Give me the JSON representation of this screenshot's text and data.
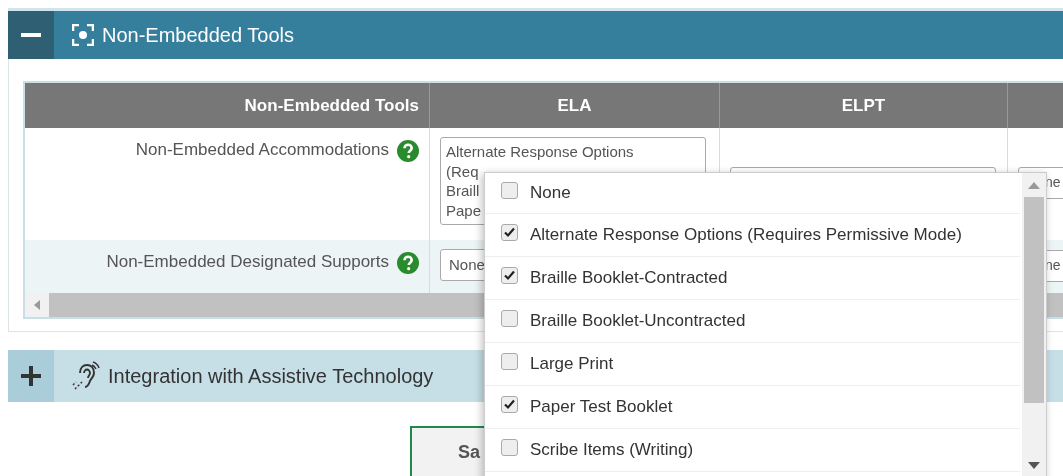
{
  "sections": [
    {
      "title": "Non-Embedded Tools",
      "expanded": true,
      "table": {
        "columns": [
          "Non-Embedded Tools",
          "ELA",
          "ELPT"
        ],
        "rows": [
          {
            "label": "Non-Embedded Accommodations",
            "ela_lines": [
              "Alternate Response Options",
              "(Req",
              "Braill",
              "Pape"
            ],
            "column_4": "ne"
          },
          {
            "label": "Non-Embedded Designated Supports",
            "ela_lines": [
              "None"
            ],
            "column_4": "ne"
          }
        ]
      }
    },
    {
      "title": "Integration with Assistive Technology",
      "expanded": false
    }
  ],
  "save_button": "Sa",
  "dropdown": {
    "options": [
      {
        "label": "None",
        "checked": false
      },
      {
        "label": "Alternate Response Options (Requires Permissive Mode)",
        "checked": true
      },
      {
        "label": "Braille Booklet-Contracted",
        "checked": true
      },
      {
        "label": "Braille Booklet-Uncontracted",
        "checked": false
      },
      {
        "label": "Large Print",
        "checked": false
      },
      {
        "label": "Paper Test Booklet",
        "checked": true
      },
      {
        "label": "Scribe Items (Writing)",
        "checked": false
      }
    ]
  }
}
